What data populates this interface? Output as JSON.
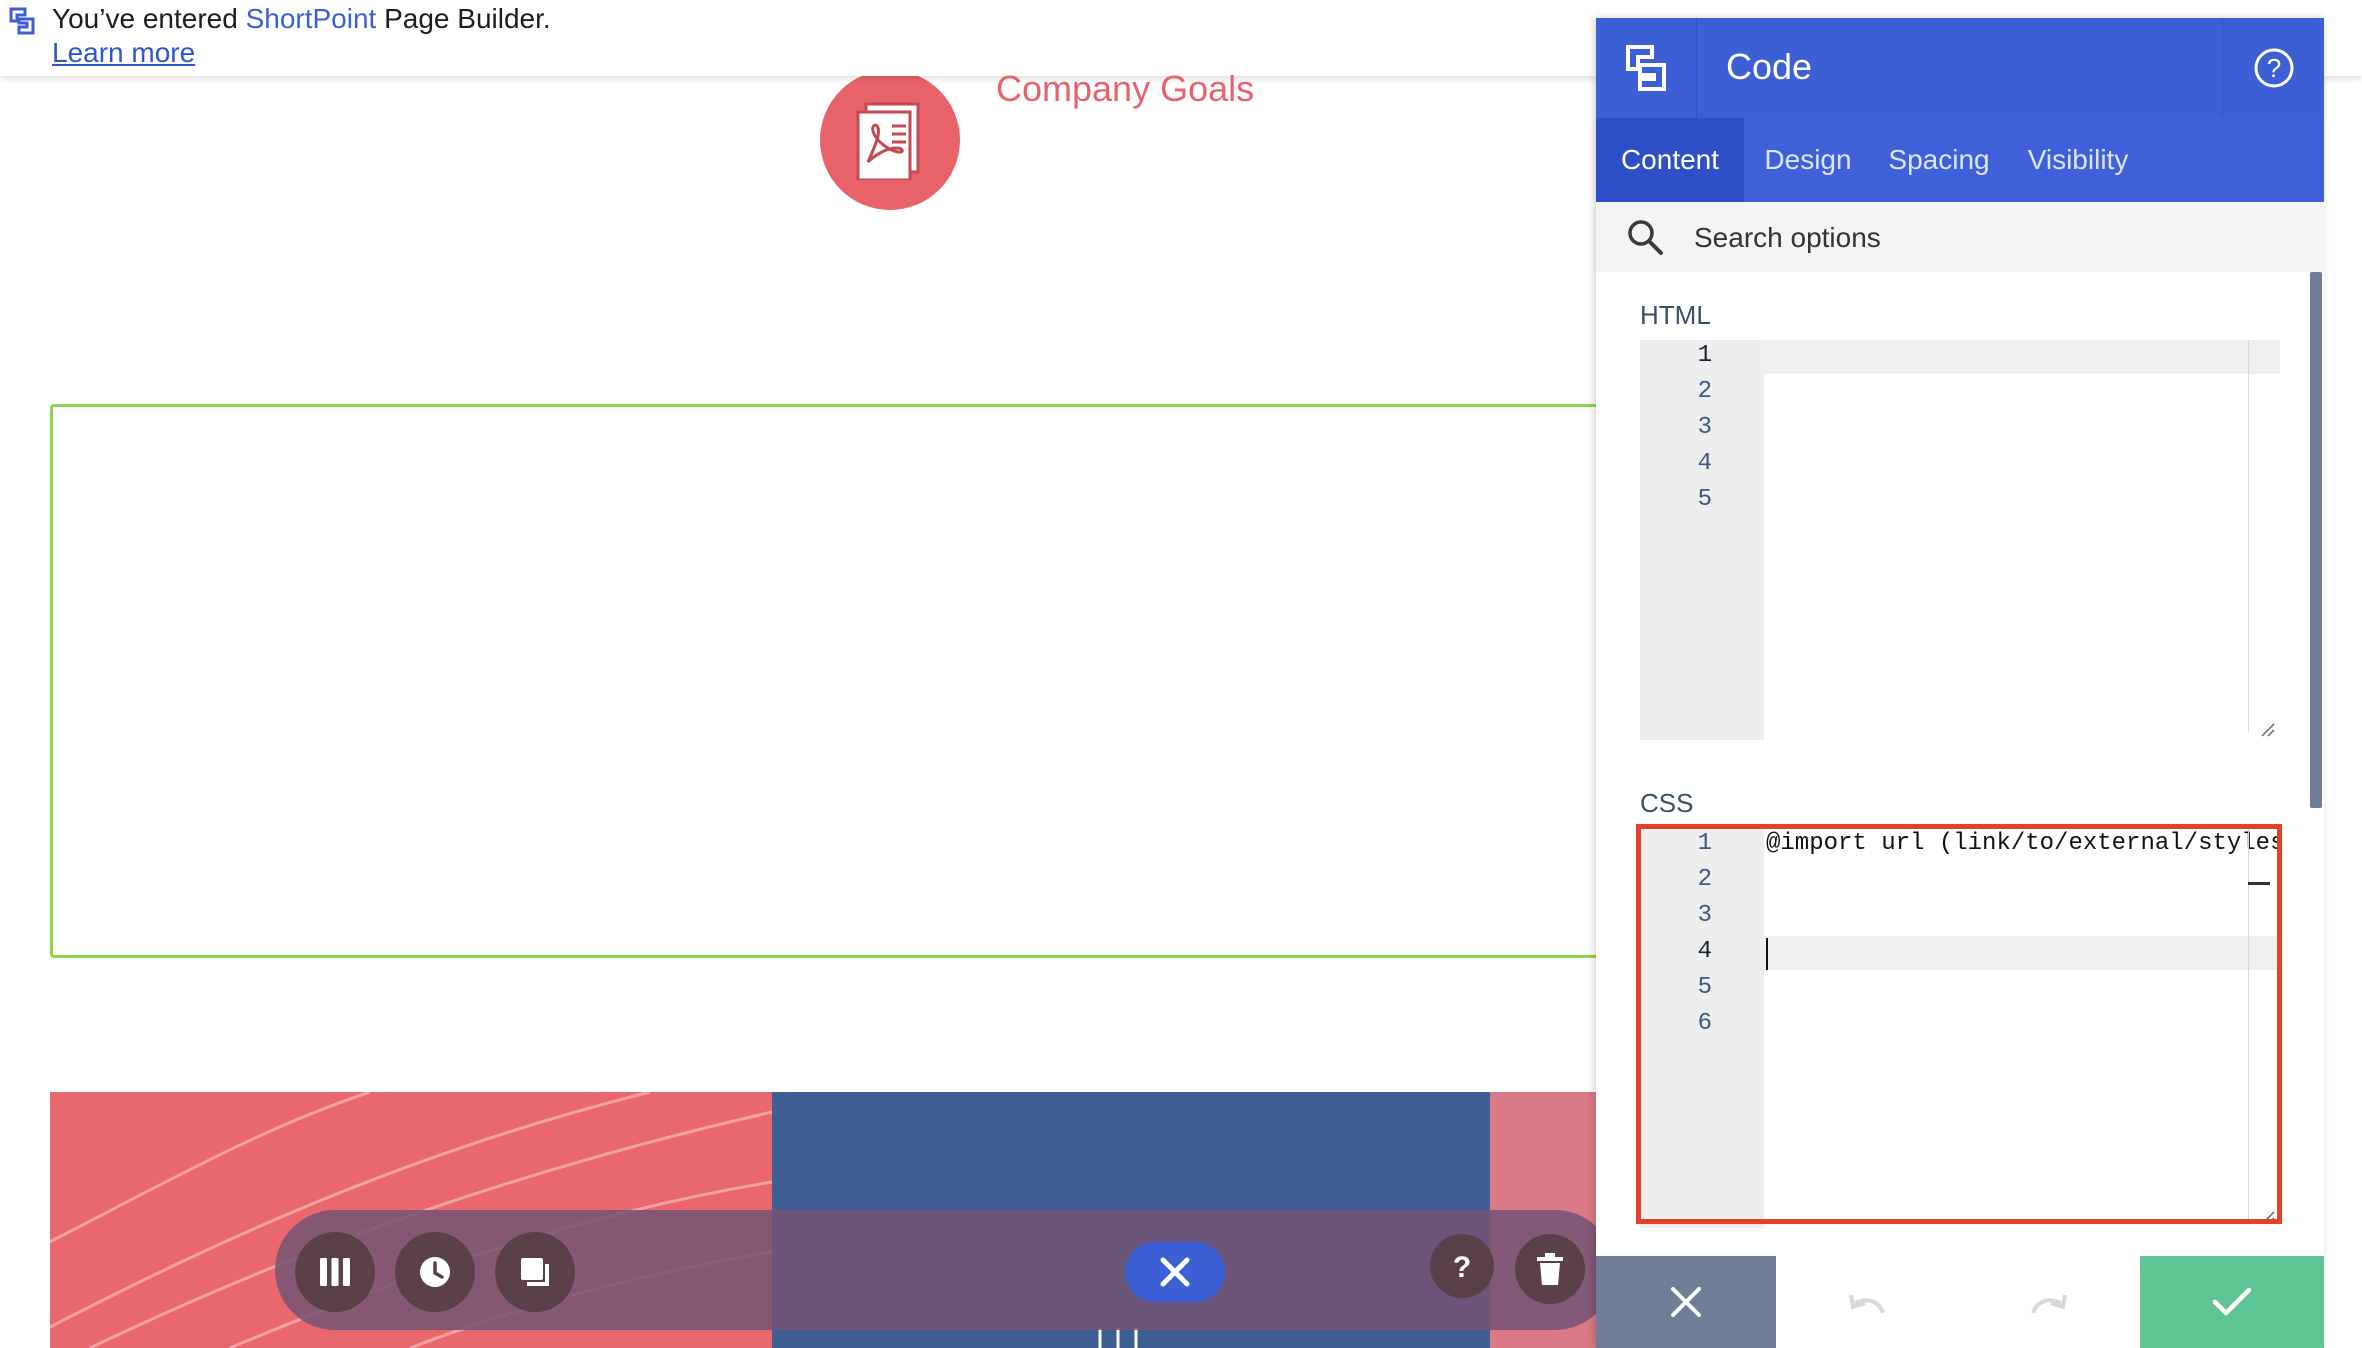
{
  "notification": {
    "prefix": "You’ve entered ",
    "brand": "ShortPoint",
    "suffix": " Page Builder.",
    "learn_more": "Learn more"
  },
  "page": {
    "company_goals": "Company Goals"
  },
  "panel": {
    "title": "Code",
    "tabs": [
      {
        "label": "Content",
        "active": true
      },
      {
        "label": "Design",
        "active": false
      },
      {
        "label": "Spacing",
        "active": false
      },
      {
        "label": "Visibility",
        "active": false
      }
    ],
    "search_placeholder": "Search options",
    "html_label": "HTML",
    "html_line_numbers": [
      "1",
      "2",
      "3",
      "4",
      "5"
    ],
    "css_label": "CSS",
    "css_line_numbers": [
      "1",
      "2",
      "3",
      "4",
      "5",
      "6"
    ],
    "css_lines": [
      "@import url (link/to/external/styles",
      "",
      "",
      "",
      "",
      ""
    ]
  },
  "icons": {
    "brand": "shortpoint-logo-icon",
    "help": "help-circle-icon",
    "search": "search-icon",
    "pdf": "pdf-file-icon",
    "columns": "columns-icon",
    "history": "clock-icon",
    "copy": "copy-icon",
    "close": "close-icon",
    "question": "question-icon",
    "delete": "trash-icon",
    "undo": "undo-icon",
    "redo": "redo-icon",
    "confirm": "check-icon"
  },
  "colors": {
    "brand_blue": "#3d5fd6",
    "accent_red": "#e8626a",
    "confirm_green": "#5ec493",
    "highlight_red": "#e4412d"
  }
}
